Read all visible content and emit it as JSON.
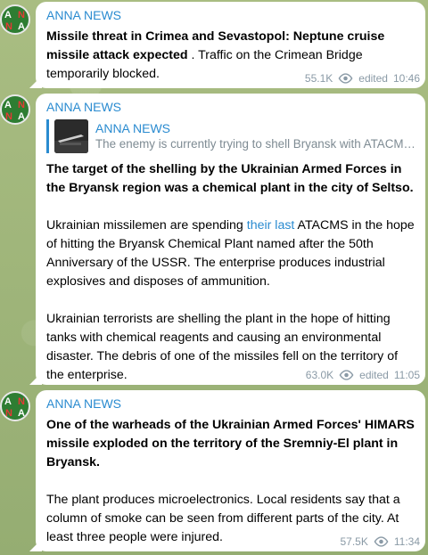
{
  "messages": [
    {
      "sender": "ANNA NEWS",
      "bold": "Missile threat in Crimea and Sevastopol: Neptune cruise missile attack expected",
      "rest": " . Traffic on the Crimean Bridge temporarily blocked.",
      "views": "55.1K",
      "edited": "edited",
      "time": "10:46"
    },
    {
      "sender": "ANNA NEWS",
      "reply_name": "ANNA NEWS",
      "reply_text": "The enemy is currently trying to shell Bryansk with ATACM…",
      "bold": "The target of the shelling by the Ukrainian Armed Forces in the Bryansk region was a chemical plant in the city of Seltso.",
      "p2_pre": "Ukrainian missilemen are spending ",
      "p2_link": "their last",
      "p2_post": " ATACMS in the hope of hitting the Bryansk Chemical Plant named after the 50th Anniversary of the USSR. The enterprise produces industrial explosives and disposes of ammunition.",
      "p3": "Ukrainian terrorists are shelling the plant in the hope of hitting tanks with chemical reagents and causing an environmental disaster. The debris of one of the missiles fell on the territory of the enterprise.",
      "views": "63.0K",
      "edited": "edited",
      "time": "11:05"
    },
    {
      "sender": "ANNA NEWS",
      "bold": "One of the warheads of the Ukrainian Armed Forces' HIMARS missile exploded on the territory of the Sremniy-El plant in Bryansk.",
      "p2": "The plant produces microelectronics. Local residents say that a column of smoke can be seen from different parts of the city. At least three people were injured.",
      "views": "57.5K",
      "time": "11:34"
    }
  ],
  "avatar_letters": [
    "A",
    "N",
    "N",
    "A"
  ],
  "colors": {
    "accent": "#2a8bd0",
    "meta": "#8a9aa6",
    "avatar_bg": "#2e7d32"
  }
}
